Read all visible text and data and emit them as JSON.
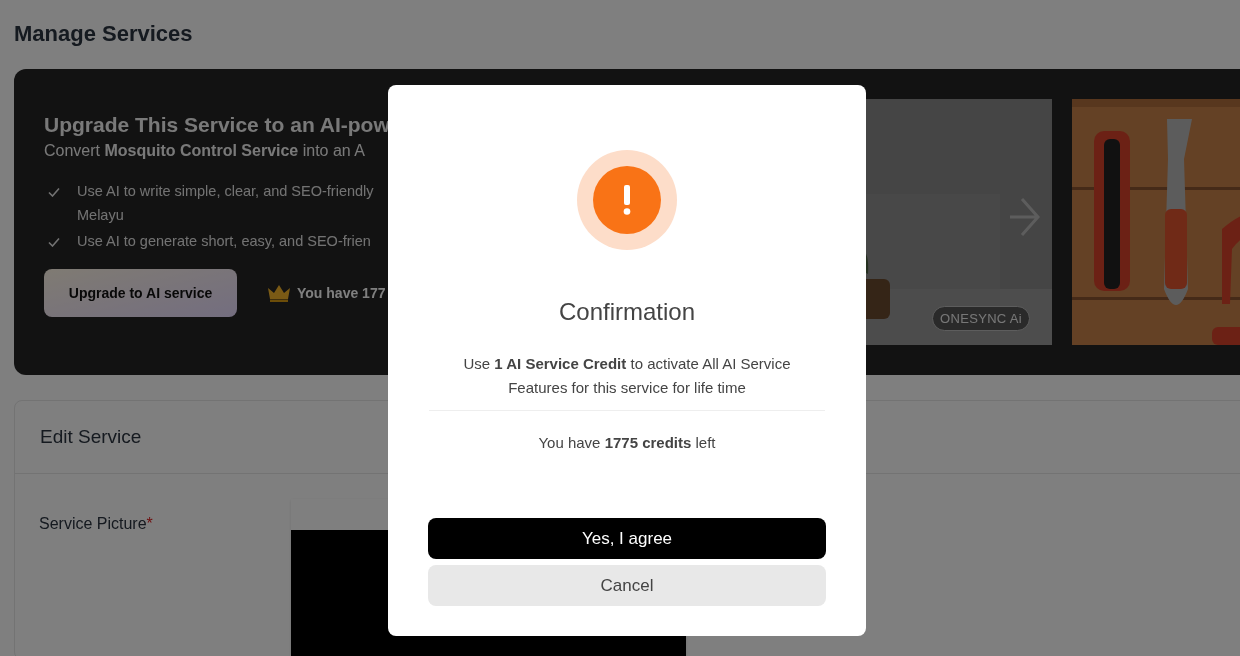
{
  "page": {
    "title": "Manage Services"
  },
  "banner": {
    "title": "Upgrade This Service to an AI-pow",
    "subtitle": "Convert **Mosquito Control Service** into an A",
    "features": [
      {
        "lines": [
          "Use AI to write simple, clear, and SEO-friendly",
          "Melayu"
        ]
      },
      {
        "lines": [
          "Use AI to generate short, easy, and SEO-frien"
        ]
      }
    ],
    "upgrade_button": "Upgrade to AI service",
    "credits_note": "You have 177",
    "badge": "ONESYNC Ai"
  },
  "edit_card": {
    "title": "Edit Service",
    "fields": [
      {
        "label": "Service Picture",
        "required_mark": "*"
      }
    ]
  },
  "modal": {
    "title": "Confirmation",
    "message": "Use **1 AI Service Credit** to activate All AI Service Features for this service for life time",
    "credits": "You have **1775 credits** left",
    "buttons": [
      {
        "label": "Yes, I agree",
        "kind": "primary"
      },
      {
        "label": "Cancel",
        "kind": "secondary"
      }
    ]
  }
}
